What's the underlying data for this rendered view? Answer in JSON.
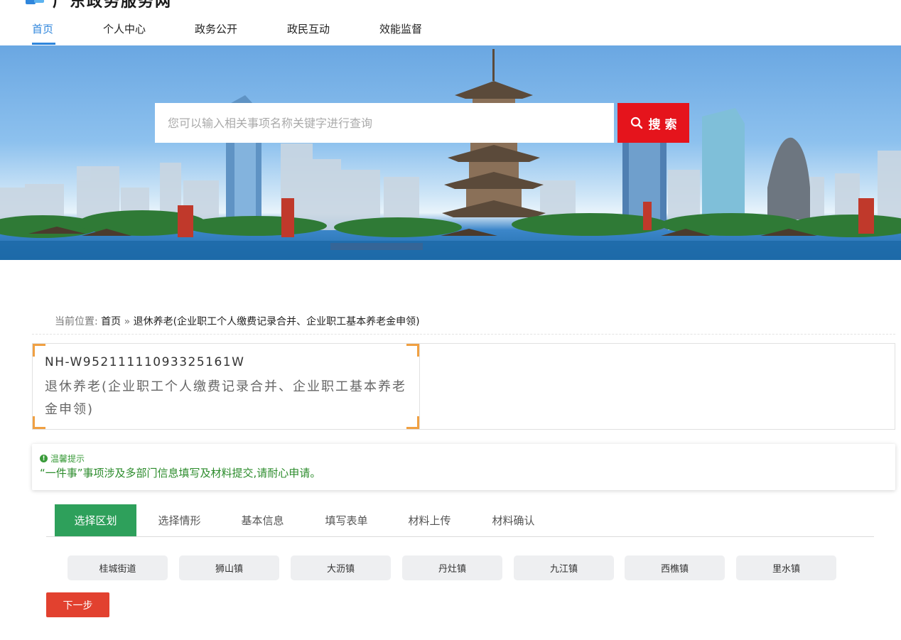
{
  "site": {
    "title": "广东政务服务网"
  },
  "nav": {
    "items": [
      {
        "label": "首页"
      },
      {
        "label": "个人中心"
      },
      {
        "label": "政务公开"
      },
      {
        "label": "政民互动"
      },
      {
        "label": "效能监督"
      }
    ]
  },
  "search": {
    "placeholder": "您可以输入相关事项名称关键字进行查询",
    "button_label": "搜 索"
  },
  "breadcrumb": {
    "prefix": "当前位置:",
    "home": "首页",
    "separator": "»",
    "current": "退休养老(企业职工个人缴费记录合并、企业职工基本养老金申领)"
  },
  "item": {
    "code": "NH-W95211111093325161W",
    "title": "退休养老(企业职工个人缴费记录合并、企业职工基本养老金申领)"
  },
  "tip": {
    "heading": "温馨提示",
    "message": "“一件事”事项涉及多部门信息填写及材料提交,请耐心申请。"
  },
  "steps": [
    {
      "label": "选择区划"
    },
    {
      "label": "选择情形"
    },
    {
      "label": "基本信息"
    },
    {
      "label": "填写表单"
    },
    {
      "label": "材料上传"
    },
    {
      "label": "材料确认"
    }
  ],
  "districts": [
    {
      "label": "桂城街道"
    },
    {
      "label": "狮山镇"
    },
    {
      "label": "大沥镇"
    },
    {
      "label": "丹灶镇"
    },
    {
      "label": "九江镇"
    },
    {
      "label": "西樵镇"
    },
    {
      "label": "里水镇"
    }
  ],
  "next_button": "下一步",
  "colors": {
    "accent_blue": "#2f86dc",
    "search_red": "#e5141c",
    "step_green": "#2ea05b",
    "tip_green": "#2c8c2c",
    "next_red": "#e2412f",
    "corner_orange": "#f0a042"
  }
}
